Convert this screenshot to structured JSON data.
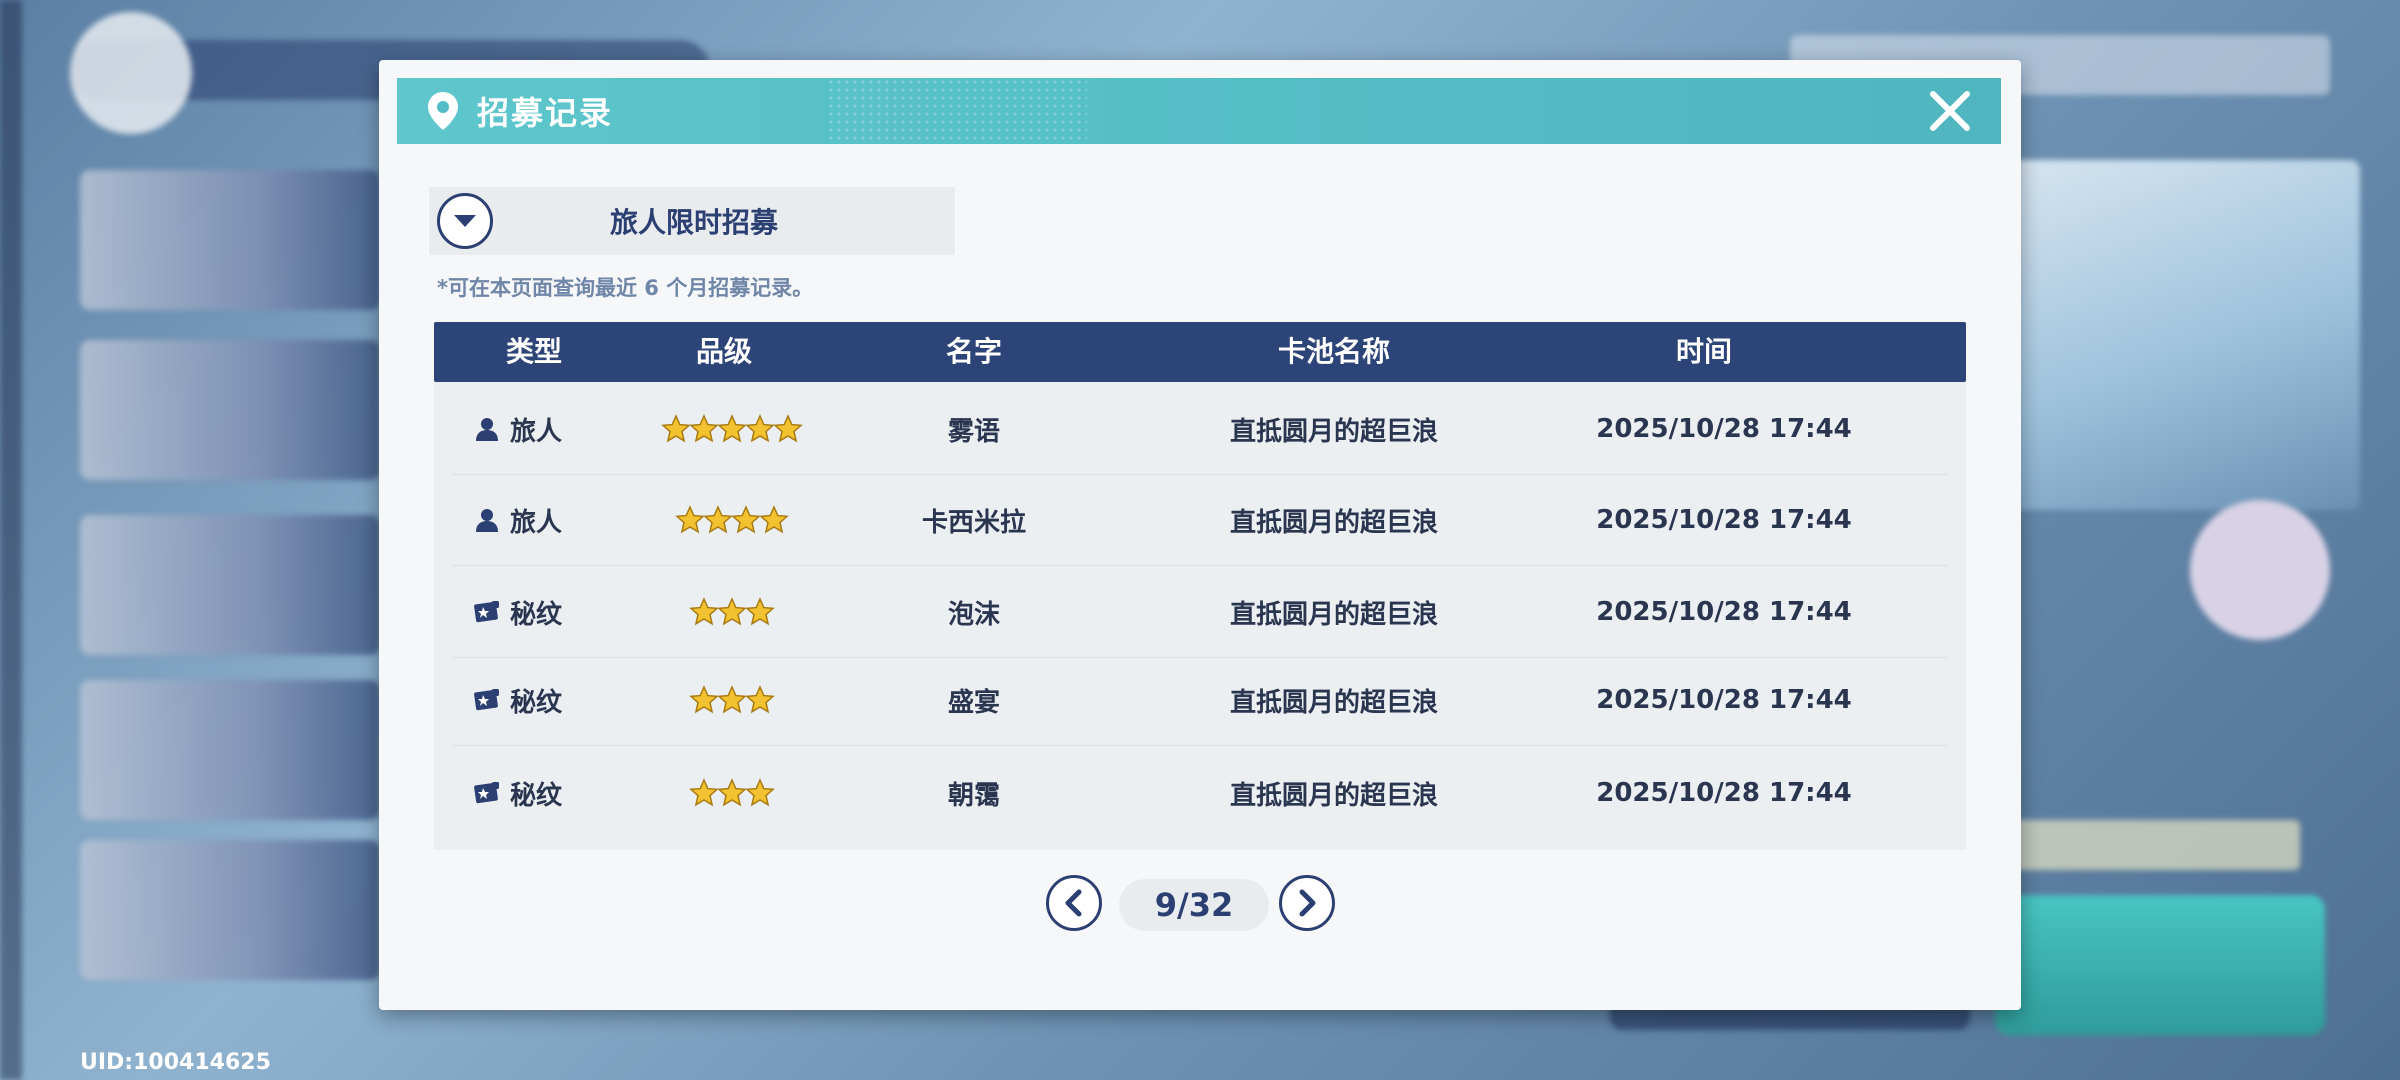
{
  "app": {
    "uid_text": "UID:100414625"
  },
  "modal": {
    "title": "招募记录",
    "pool_selector": "旅人限时招募",
    "note": "*可在本页面查询最近 6 个月招募记录。"
  },
  "table": {
    "headers": [
      "类型",
      "品级",
      "名字",
      "卡池名称",
      "时间"
    ],
    "rows": [
      {
        "type": "旅人",
        "type_icon": "person-icon",
        "stars": 5,
        "name": "雾语",
        "pool": "直抵圆月的超巨浪",
        "time": "2025/10/28 17:44"
      },
      {
        "type": "旅人",
        "type_icon": "person-icon",
        "stars": 4,
        "name": "卡西米拉",
        "pool": "直抵圆月的超巨浪",
        "time": "2025/10/28 17:44"
      },
      {
        "type": "秘纹",
        "type_icon": "card-icon",
        "stars": 3,
        "name": "泡沫",
        "pool": "直抵圆月的超巨浪",
        "time": "2025/10/28 17:44"
      },
      {
        "type": "秘纹",
        "type_icon": "card-icon",
        "stars": 3,
        "name": "盛宴",
        "pool": "直抵圆月的超巨浪",
        "time": "2025/10/28 17:44"
      },
      {
        "type": "秘纹",
        "type_icon": "card-icon",
        "stars": 3,
        "name": "朝霭",
        "pool": "直抵圆月的超巨浪",
        "time": "2025/10/28 17:44"
      }
    ]
  },
  "pager": {
    "label": "9/32",
    "current": 9,
    "total": 32
  },
  "colors": {
    "header_teal": "#56c0c7",
    "navy": "#2c4477",
    "star_gold": "#f2c230"
  }
}
